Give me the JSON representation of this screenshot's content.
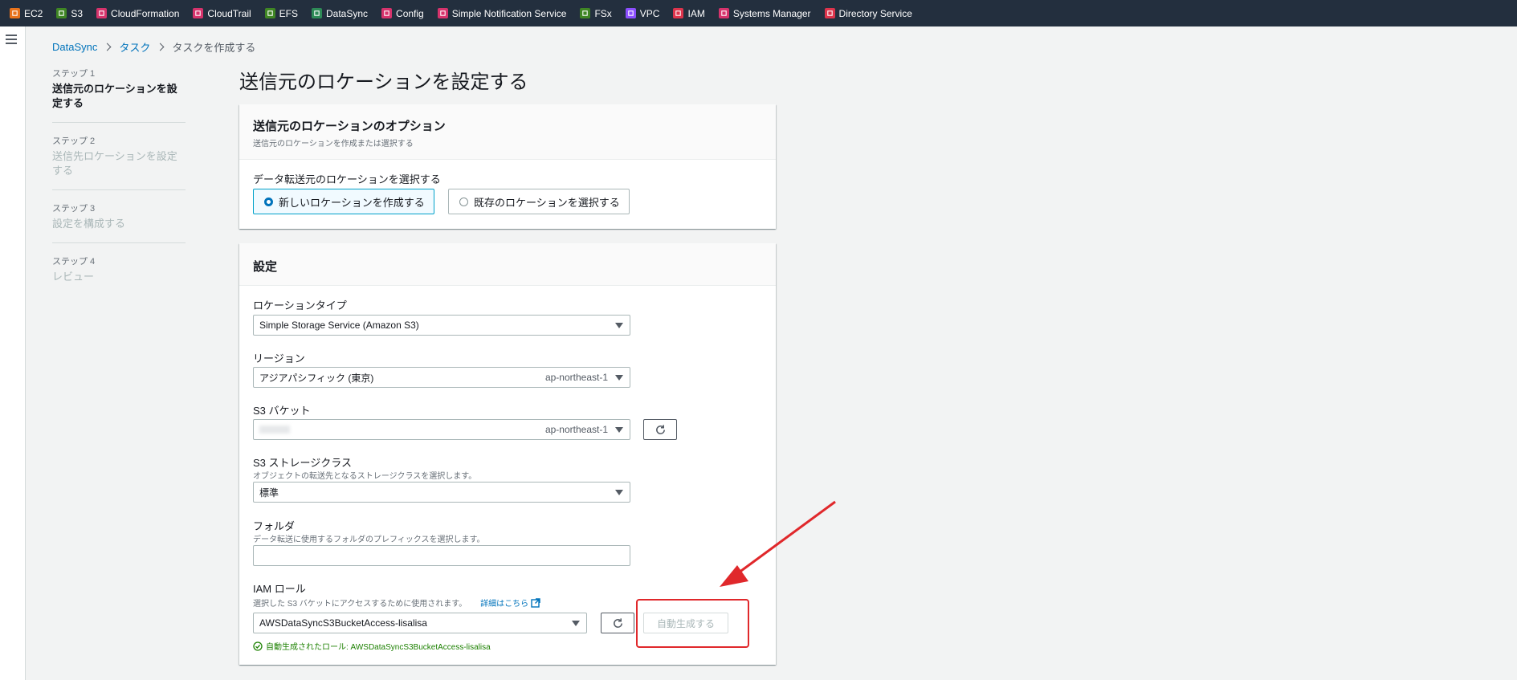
{
  "topbar": {
    "services": [
      {
        "label": "EC2",
        "color": "#e8731c",
        "icon": "ec2-icon"
      },
      {
        "label": "S3",
        "color": "#3f8624",
        "icon": "s3-icon"
      },
      {
        "label": "CloudFormation",
        "color": "#d6336c",
        "icon": "cloudformation-icon"
      },
      {
        "label": "CloudTrail",
        "color": "#d6336c",
        "icon": "cloudtrail-icon"
      },
      {
        "label": "EFS",
        "color": "#3f8624",
        "icon": "efs-icon"
      },
      {
        "label": "DataSync",
        "color": "#2e8b57",
        "icon": "datasync-icon"
      },
      {
        "label": "Config",
        "color": "#d6336c",
        "icon": "config-icon"
      },
      {
        "label": "Simple Notification Service",
        "color": "#d6336c",
        "icon": "sns-icon"
      },
      {
        "label": "FSx",
        "color": "#3f8624",
        "icon": "fsx-icon"
      },
      {
        "label": "VPC",
        "color": "#8c4fff",
        "icon": "vpc-icon"
      },
      {
        "label": "IAM",
        "color": "#dd344c",
        "icon": "iam-icon"
      },
      {
        "label": "Systems Manager",
        "color": "#d6336c",
        "icon": "systems-manager-icon"
      },
      {
        "label": "Directory Service",
        "color": "#dd344c",
        "icon": "directory-service-icon"
      }
    ]
  },
  "breadcrumb": {
    "items": [
      "DataSync",
      "タスク"
    ],
    "current": "タスクを作成する"
  },
  "steps": [
    {
      "num": "ステップ 1",
      "title": "送信元のロケーションを設定する",
      "active": true
    },
    {
      "num": "ステップ 2",
      "title": "送信先ロケーションを設定する",
      "active": false
    },
    {
      "num": "ステップ 3",
      "title": "設定を構成する",
      "active": false
    },
    {
      "num": "ステップ 4",
      "title": "レビュー",
      "active": false
    }
  ],
  "page_title": "送信元のロケーションを設定する",
  "options_panel": {
    "title": "送信元のロケーションのオプション",
    "description": "送信元のロケーションを作成または選択する",
    "field_label": "データ転送元のロケーションを選択する",
    "radio_new": "新しいロケーションを作成する",
    "radio_existing": "既存のロケーションを選択する"
  },
  "settings_panel": {
    "title": "設定",
    "location_type": {
      "label": "ロケーションタイプ",
      "value": "Simple Storage Service (Amazon S3)"
    },
    "region": {
      "label": "リージョン",
      "value": "アジアパシフィック (東京)",
      "code": "ap-northeast-1"
    },
    "s3_bucket": {
      "label": "S3 バケット",
      "code": "ap-northeast-1"
    },
    "storage_class": {
      "label": "S3 ストレージクラス",
      "hint": "オブジェクトの転送先となるストレージクラスを選択します。",
      "value": "標準"
    },
    "folder": {
      "label": "フォルダ",
      "hint": "データ転送に使用するフォルダのプレフィックスを選択します。",
      "value": ""
    },
    "iam_role": {
      "label": "IAM ロール",
      "hint": "選択した S3 バケットにアクセスするために使用されます。",
      "learn_more": "詳細はこちら",
      "value": "AWSDataSyncS3BucketAccess-lisalisa",
      "auto_button": "自動生成する",
      "success": "自動生成されたロール: AWSDataSyncS3BucketAccess-lisalisa"
    }
  },
  "colors": {
    "annotation": "#e0282b",
    "link": "#0073bb",
    "success": "#1d8102"
  }
}
